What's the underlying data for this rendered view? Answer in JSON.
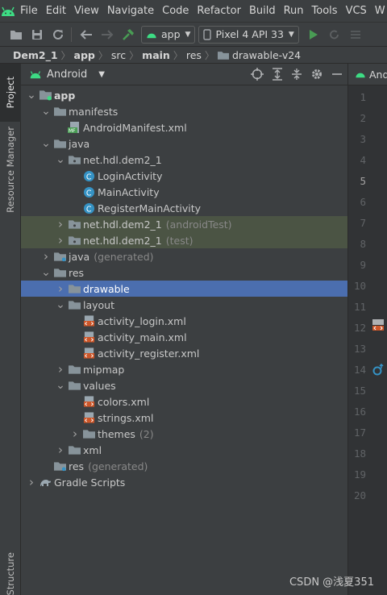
{
  "menubar": {
    "items": [
      "File",
      "Edit",
      "View",
      "Navigate",
      "Code",
      "Refactor",
      "Build",
      "Run",
      "Tools",
      "VCS",
      "W"
    ]
  },
  "toolbar": {
    "run_config": "app",
    "device": "Pixel 4 API 33"
  },
  "breadcrumb": [
    "Dem2_1",
    "app",
    "src",
    "main",
    "res",
    "drawable-v24"
  ],
  "left_strip": {
    "tabs": [
      "Project",
      "Resource Manager",
      "Structure"
    ]
  },
  "panel": {
    "view_mode": "Android"
  },
  "tree": [
    {
      "label": "app",
      "depth": 0,
      "arrow": "down",
      "icon": "module-icon",
      "bold": true
    },
    {
      "label": "manifests",
      "depth": 1,
      "arrow": "down",
      "icon": "folder-icon"
    },
    {
      "label": "AndroidManifest.xml",
      "depth": 2,
      "arrow": "",
      "icon": "manifest-file-icon"
    },
    {
      "label": "java",
      "depth": 1,
      "arrow": "down",
      "icon": "folder-icon"
    },
    {
      "label": "net.hdl.dem2_1",
      "depth": 2,
      "arrow": "down",
      "icon": "package-icon"
    },
    {
      "label": "LoginActivity",
      "depth": 3,
      "arrow": "",
      "icon": "class-icon"
    },
    {
      "label": "MainActivity",
      "depth": 3,
      "arrow": "",
      "icon": "class-icon"
    },
    {
      "label": "RegisterMainActivity",
      "depth": 3,
      "arrow": "",
      "icon": "class-icon"
    },
    {
      "label": "net.hdl.dem2_1",
      "suffix": "(androidTest)",
      "depth": 2,
      "arrow": "right",
      "icon": "package-icon",
      "tests": true
    },
    {
      "label": "net.hdl.dem2_1",
      "suffix": "(test)",
      "depth": 2,
      "arrow": "right",
      "icon": "package-icon",
      "tests": true
    },
    {
      "label": "java",
      "suffix": "(generated)",
      "depth": 1,
      "arrow": "right",
      "icon": "generated-folder-icon"
    },
    {
      "label": "res",
      "depth": 1,
      "arrow": "down",
      "icon": "folder-icon"
    },
    {
      "label": "drawable",
      "depth": 2,
      "arrow": "right",
      "icon": "folder-icon",
      "selected": true
    },
    {
      "label": "layout",
      "depth": 2,
      "arrow": "down",
      "icon": "folder-icon"
    },
    {
      "label": "activity_login.xml",
      "depth": 3,
      "arrow": "",
      "icon": "layout-file-icon"
    },
    {
      "label": "activity_main.xml",
      "depth": 3,
      "arrow": "",
      "icon": "layout-file-icon"
    },
    {
      "label": "activity_register.xml",
      "depth": 3,
      "arrow": "",
      "icon": "layout-file-icon"
    },
    {
      "label": "mipmap",
      "depth": 2,
      "arrow": "right",
      "icon": "folder-icon"
    },
    {
      "label": "values",
      "depth": 2,
      "arrow": "down",
      "icon": "folder-icon"
    },
    {
      "label": "colors.xml",
      "depth": 3,
      "arrow": "",
      "icon": "values-file-icon"
    },
    {
      "label": "strings.xml",
      "depth": 3,
      "arrow": "",
      "icon": "values-file-icon"
    },
    {
      "label": "themes",
      "suffix": "(2)",
      "depth": 3,
      "arrow": "right",
      "icon": "folder-icon"
    },
    {
      "label": "xml",
      "depth": 2,
      "arrow": "right",
      "icon": "folder-icon"
    },
    {
      "label": "res",
      "suffix": "(generated)",
      "depth": 1,
      "arrow": "",
      "icon": "generated-folder-icon"
    },
    {
      "label": "Gradle Scripts",
      "depth": 0,
      "arrow": "right",
      "icon": "gradle-icon"
    }
  ],
  "editor": {
    "tab_label": "Andro",
    "line_numbers": [
      "1",
      "2",
      "3",
      "4",
      "5",
      "6",
      "7",
      "8",
      "9",
      "10",
      "11",
      "12",
      "13",
      "14",
      "15",
      "16",
      "17",
      "18",
      "19",
      "20"
    ],
    "current_line": "5"
  },
  "watermark": "CSDN @浅夏351",
  "colors": {
    "background": "#3c3f41",
    "selection": "#4b6eaf",
    "test_rows": "#4b5444",
    "folder": "#87939a",
    "android_green": "#3ddc84",
    "class_icon": "#3592c4"
  }
}
